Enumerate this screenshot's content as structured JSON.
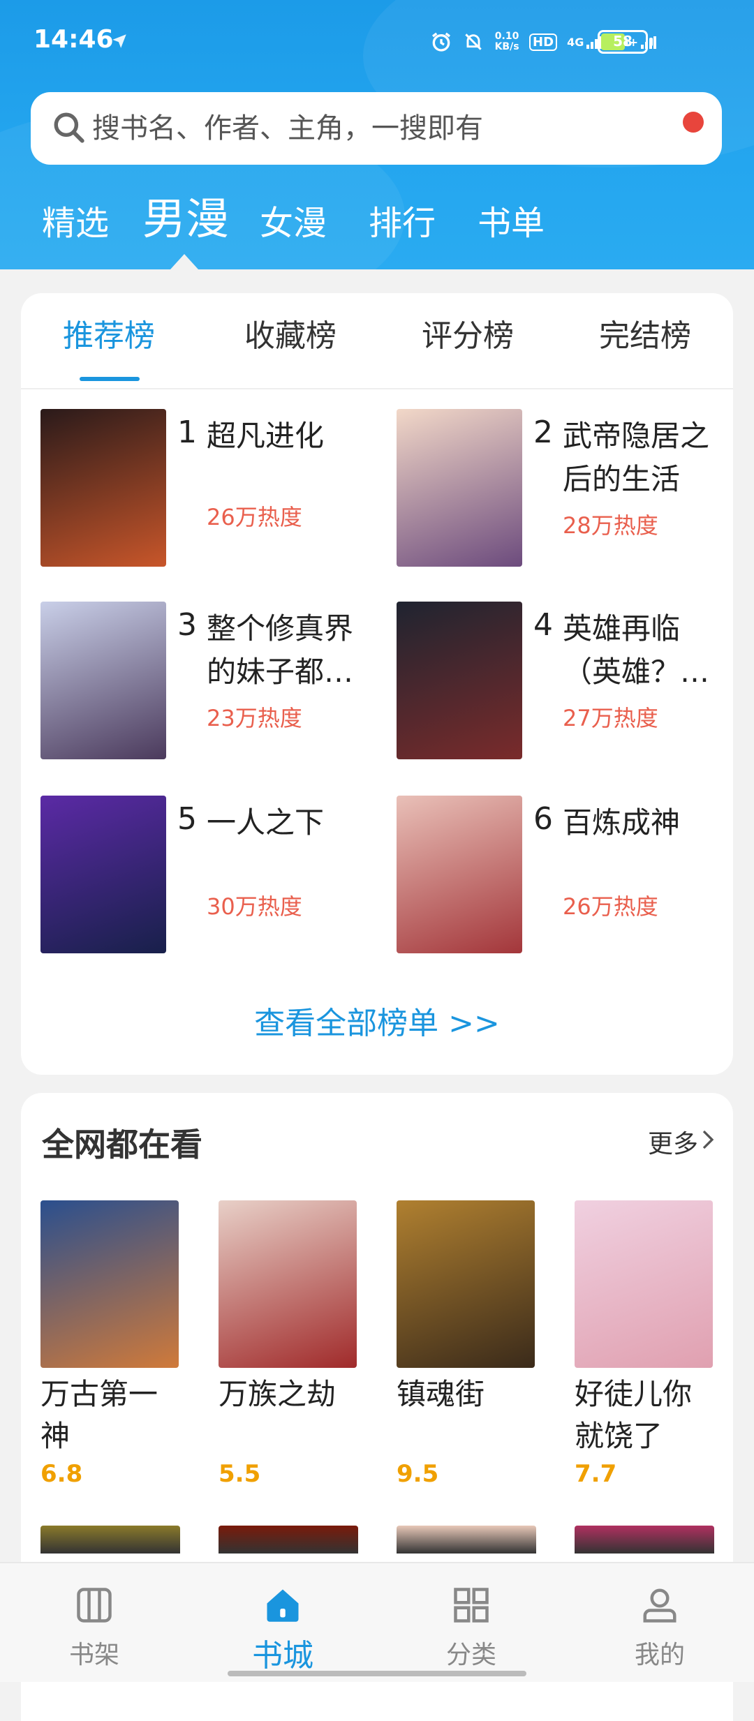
{
  "status_bar": {
    "time": "14:46",
    "net_speed": "0.10\nKB/s",
    "hd": "HD",
    "sig1": "4G",
    "sig2": "4G+",
    "battery": "58"
  },
  "search": {
    "placeholder": "搜书名、作者、主角，一搜即有"
  },
  "top_tabs": [
    "精选",
    "男漫",
    "女漫",
    "排行",
    "书单"
  ],
  "active_top_tab": "男漫",
  "rank_tabs": [
    "推荐榜",
    "收藏榜",
    "评分榜",
    "完结榜"
  ],
  "rank_items": [
    {
      "num": "1",
      "name": "超凡进化",
      "heat": "26万热度",
      "colors": [
        "#2a1a1a",
        "#c8562a"
      ]
    },
    {
      "num": "2",
      "name": "武帝隐居之后的生活",
      "heat": "28万热度",
      "colors": [
        "#f2d8c8",
        "#6c4b7d"
      ]
    },
    {
      "num": "3",
      "name": "整个修真界的妹子都…",
      "heat": "23万热度",
      "colors": [
        "#c9cfe8",
        "#4b3a5c"
      ]
    },
    {
      "num": "4",
      "name": "英雄再临（英雄？…",
      "heat": "27万热度",
      "colors": [
        "#1f2430",
        "#7a2b2b"
      ]
    },
    {
      "num": "5",
      "name": "一人之下",
      "heat": "30万热度",
      "colors": [
        "#5b2aa5",
        "#18204a"
      ]
    },
    {
      "num": "6",
      "name": "百炼成神",
      "heat": "26万热度",
      "colors": [
        "#e9c0b8",
        "#a3363a"
      ]
    }
  ],
  "view_all": "查看全部榜单 >>",
  "popular": {
    "title": "全网都在看",
    "more": "更多",
    "items": [
      {
        "name": "万古第一神",
        "score": "6.8",
        "colors": [
          "#2a4f8e",
          "#d07a3a"
        ]
      },
      {
        "name": "万族之劫",
        "score": "5.5",
        "colors": [
          "#e8d0c8",
          "#a02a2a"
        ]
      },
      {
        "name": "镇魂街",
        "score": "9.5",
        "colors": [
          "#b08030",
          "#3a2a1a"
        ]
      },
      {
        "name": "好徒儿你就饶了为…",
        "score": "7.7",
        "colors": [
          "#f0d0e0",
          "#e0a0b0"
        ]
      }
    ],
    "row2_colors": [
      "#8a7a2a",
      "#7a1a0a",
      "#e8c8b8",
      "#b03060"
    ]
  },
  "bottom_nav": [
    {
      "label": "书架",
      "icon": "bookshelf-icon"
    },
    {
      "label": "书城",
      "icon": "home-icon"
    },
    {
      "label": "分类",
      "icon": "category-icon"
    },
    {
      "label": "我的",
      "icon": "profile-icon"
    }
  ],
  "colors": {
    "accent": "#1a95de",
    "heat": "#e95f4d",
    "score": "#f0a000",
    "header": "#24a6ef"
  }
}
